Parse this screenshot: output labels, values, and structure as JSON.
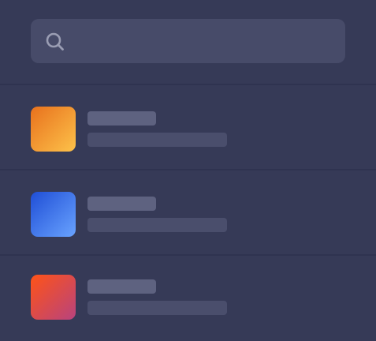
{
  "search": {
    "placeholder": "",
    "value": "",
    "icon": "search-icon"
  },
  "list": {
    "items": [
      {
        "title": "",
        "subtitle": "",
        "thumbnail_colors": [
          "#e8711d",
          "#fdc24a"
        ]
      },
      {
        "title": "",
        "subtitle": "",
        "thumbnail_colors": [
          "#1f4ed6",
          "#69a3ff"
        ]
      },
      {
        "title": "",
        "subtitle": "",
        "thumbnail_colors": [
          "#ff5317",
          "#b8437e"
        ]
      }
    ]
  },
  "colors": {
    "background": "#363a57",
    "search_bg": "#474b69",
    "divider": "#2f3350",
    "title_placeholder": "#5e6280",
    "subtitle_placeholder": "#4a4e6c"
  }
}
